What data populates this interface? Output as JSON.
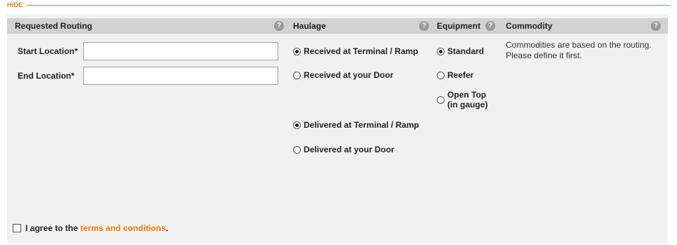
{
  "hide_label": "HIDE",
  "columns": {
    "routing": "Requested Routing",
    "haulage": "Haulage",
    "equipment": "Equipment",
    "commodity": "Commodity",
    "help_glyph": "?"
  },
  "routing": {
    "start_label": "Start Location*",
    "start_value": "",
    "end_label": "End Location*",
    "end_value": ""
  },
  "haulage": {
    "received_terminal": "Received at Terminal / Ramp",
    "received_door": "Received at your Door",
    "delivered_terminal": "Delivered at Terminal / Ramp",
    "delivered_door": "Delivered at your Door",
    "received_selected": "received_terminal",
    "delivered_selected": "delivered_terminal"
  },
  "equipment": {
    "standard": "Standard",
    "reefer": "Reefer",
    "open_top_line1": "Open Top",
    "open_top_line2": "(in gauge)",
    "selected": "standard"
  },
  "commodity": {
    "note": "Commodities are based on the routing. Please define it first."
  },
  "agreement": {
    "prefix": "I agree to the ",
    "link": "terms and conditions",
    "suffix": ".",
    "checked": false
  },
  "colors": {
    "accent": "#f07a1a",
    "header_bg": "#d2d2d2",
    "panel_bg": "#f1f1f1"
  }
}
